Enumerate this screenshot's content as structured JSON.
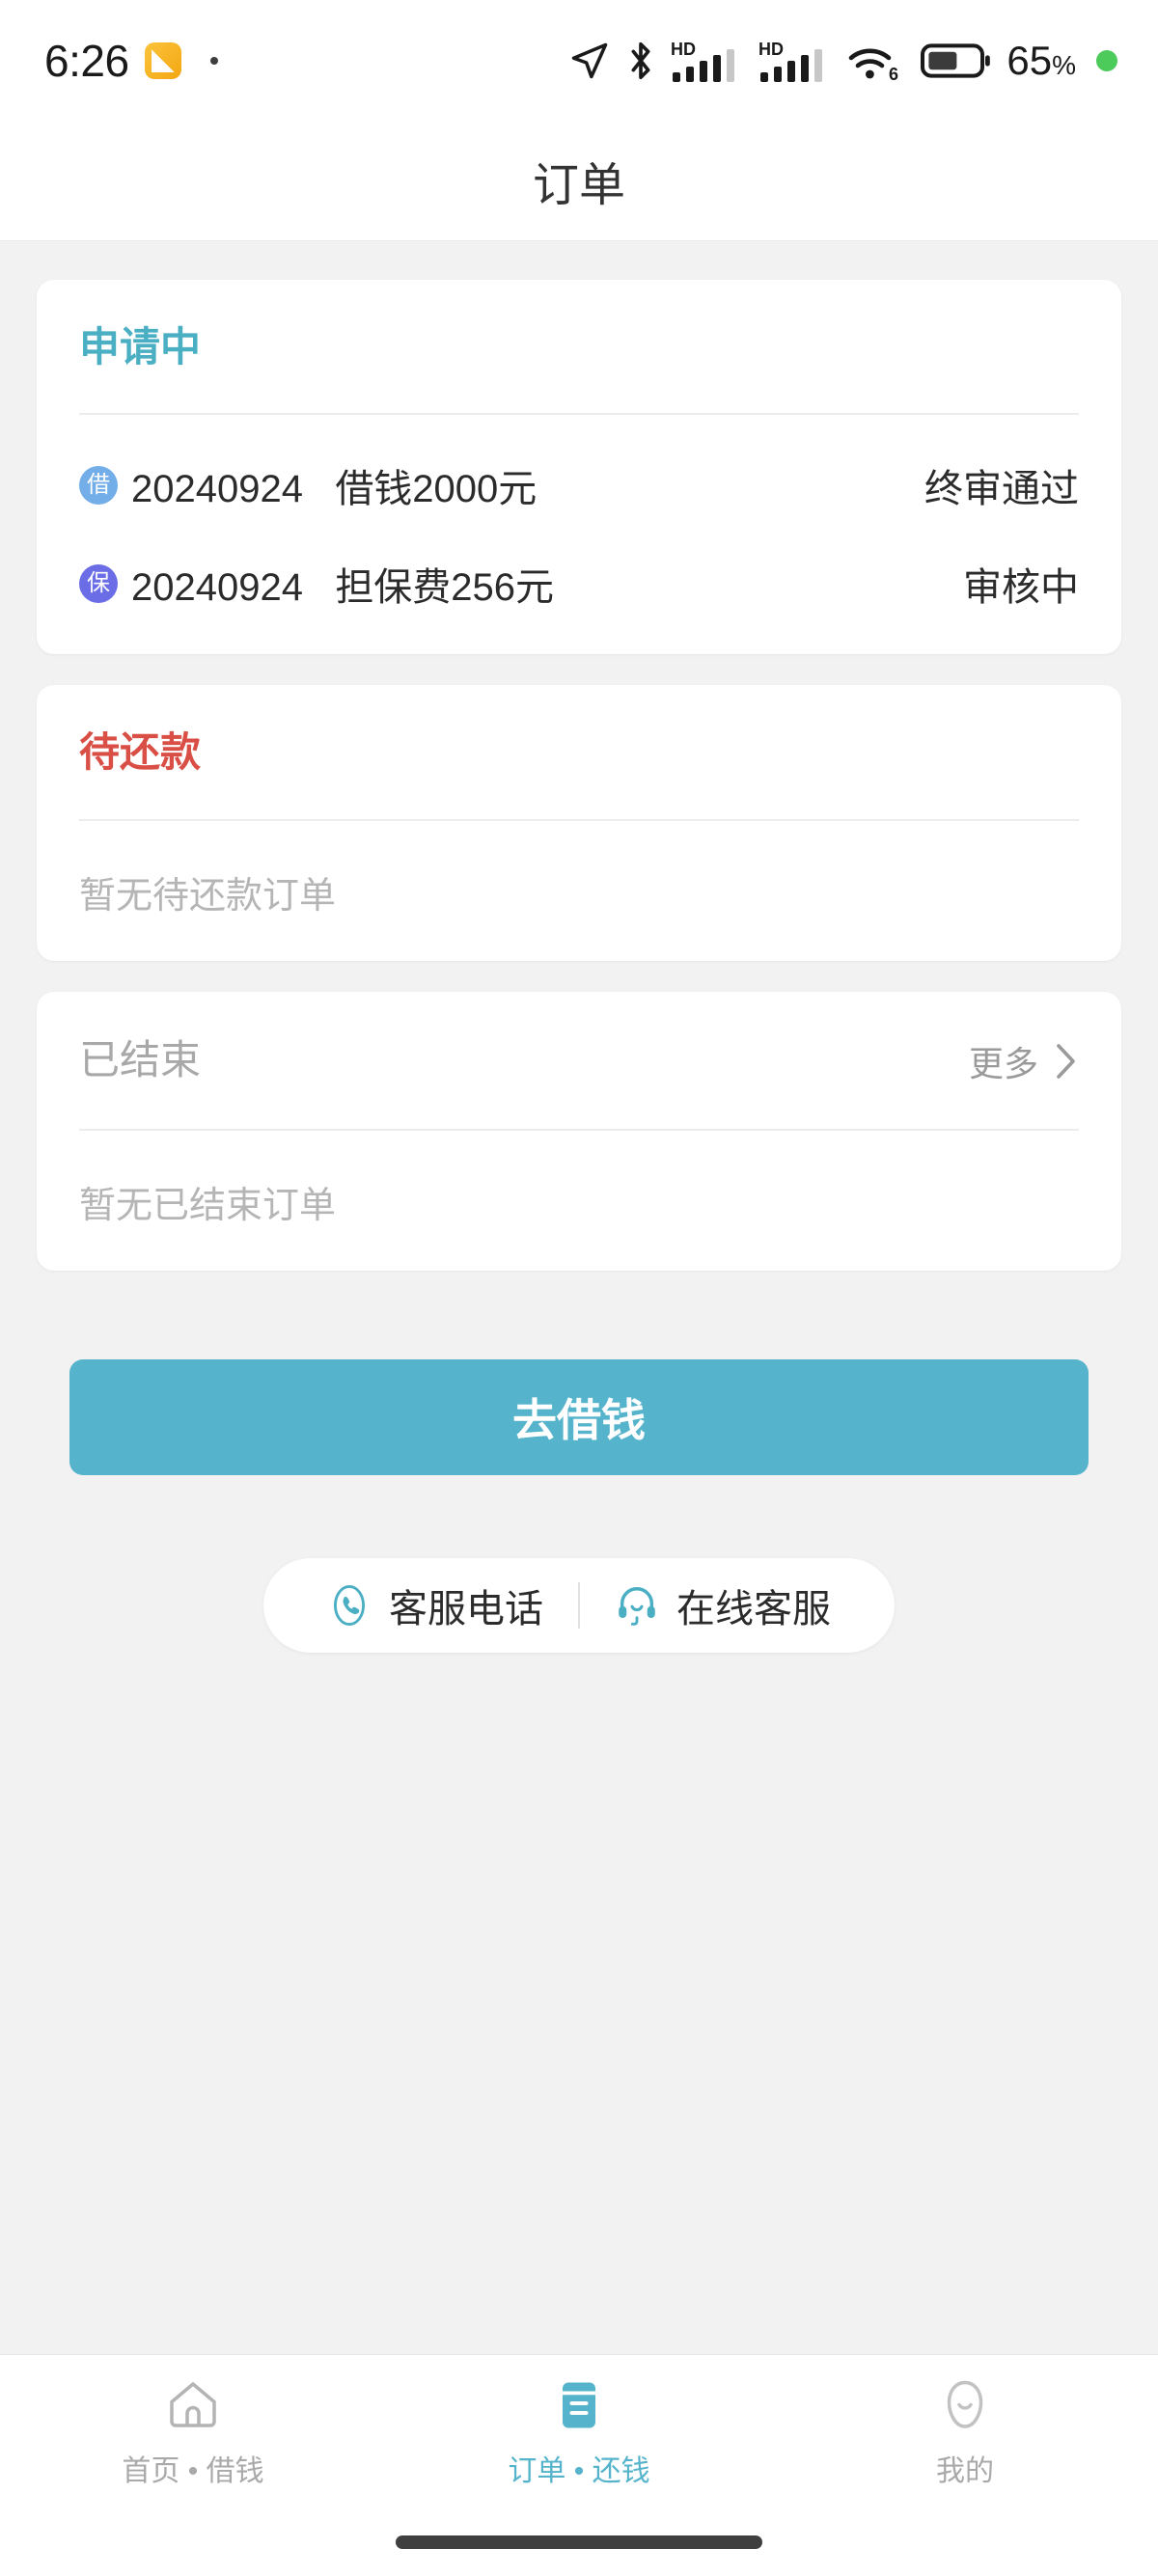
{
  "status_bar": {
    "time": "6:26",
    "battery_percent": "65",
    "percent_symbol": "%",
    "icons": [
      "location-arrow-icon",
      "bluetooth-icon",
      "hd-signal-icon-1",
      "hd-signal-icon-2",
      "wifi6-icon",
      "battery-icon",
      "green-dot-icon"
    ],
    "hd_label": "HD",
    "wifi_generation": "6"
  },
  "header": {
    "title": "订单"
  },
  "cards": [
    {
      "id": "applying",
      "title": "申请中",
      "title_color": "#4bafc4",
      "rows": [
        {
          "badge": "借",
          "badge_color": "#74aee8",
          "date": "20240924",
          "desc": "借钱2000元",
          "status": "终审通过"
        },
        {
          "badge": "保",
          "badge_color": "#6a6de6",
          "date": "20240924",
          "desc": "担保费256元",
          "status": "审核中"
        }
      ],
      "empty_text": ""
    },
    {
      "id": "pending-repayment",
      "title": "待还款",
      "title_color": "#d94f46",
      "rows": [],
      "empty_text": "暂无待还款订单"
    },
    {
      "id": "finished",
      "title": "已结束",
      "title_color": "#a8a8a8",
      "more_label": "更多",
      "rows": [],
      "empty_text": "暂无已结束订单"
    }
  ],
  "cta": {
    "label": "去借钱",
    "color": "#55b4cb"
  },
  "service": {
    "phone": {
      "label": "客服电话",
      "icon": "phone-icon"
    },
    "online": {
      "label": "在线客服",
      "icon": "headset-icon"
    }
  },
  "tabbar": {
    "active_color": "#55b4cb",
    "inactive_color": "#a9a9a9",
    "items": [
      {
        "label": "首页 • 借钱",
        "icon": "home-icon",
        "active": false
      },
      {
        "label": "订单 • 还钱",
        "icon": "orders-icon",
        "active": true
      },
      {
        "label": "我的",
        "icon": "profile-icon",
        "active": false
      }
    ]
  }
}
